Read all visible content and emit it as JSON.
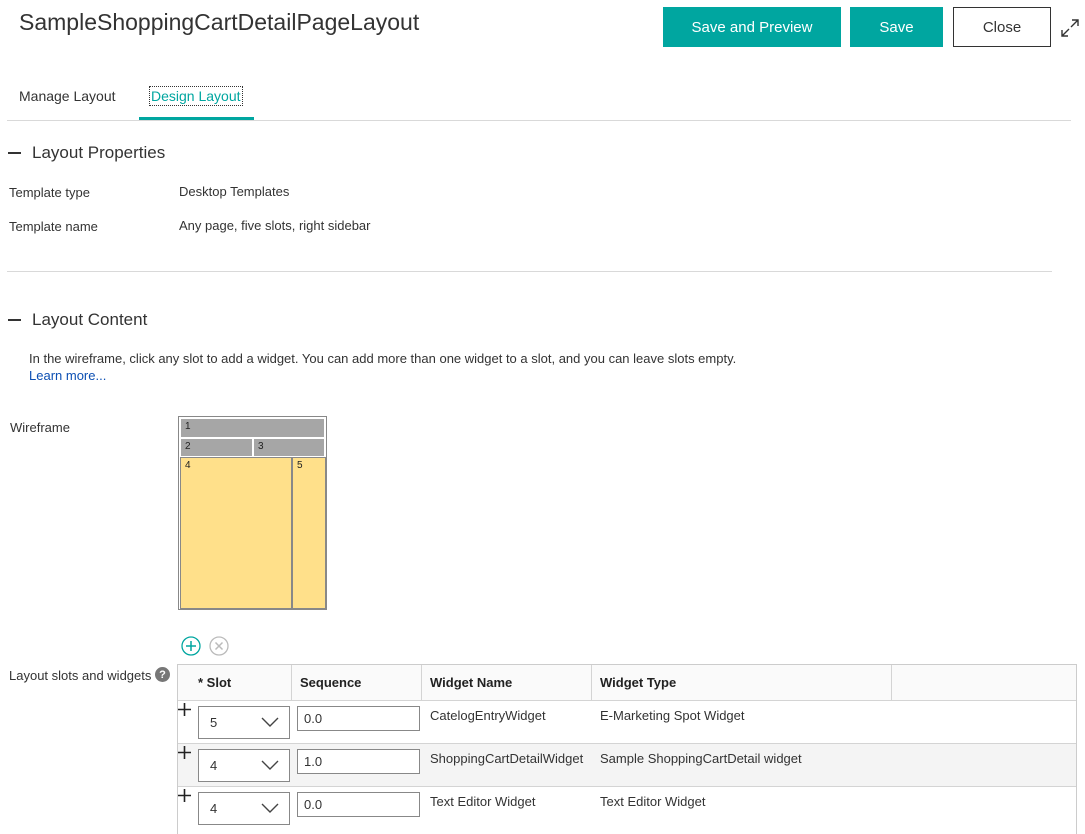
{
  "header": {
    "title": "SampleShoppingCartDetailPageLayout",
    "save_preview_label": "Save and Preview",
    "save_label": "Save",
    "close_label": "Close",
    "accent_color": "#00a6a0"
  },
  "tabs": [
    {
      "label": "Manage Layout",
      "active": false
    },
    {
      "label": "Design Layout",
      "active": true
    }
  ],
  "layout_properties": {
    "title": "Layout Properties",
    "template_type_label": "Template type",
    "template_type_value": "Desktop Templates",
    "template_name_label": "Template name",
    "template_name_value": "Any page, five slots, right sidebar"
  },
  "layout_content": {
    "title": "Layout Content",
    "instructions": "In the wireframe, click any slot to add a widget. You can add more than one widget to a slot, and you can leave slots empty.",
    "learn_more": "Learn more...",
    "wireframe_label": "Wireframe",
    "slots": [
      "1",
      "2",
      "3",
      "4",
      "5"
    ],
    "slots_widgets_label": "Layout slots and widgets"
  },
  "table": {
    "headers": {
      "slot": "* Slot",
      "sequence": "Sequence",
      "widget_name": "Widget Name",
      "widget_type": "Widget Type"
    },
    "rows": [
      {
        "slot": "5",
        "sequence": "0.0",
        "widget_name": "CatelogEntryWidget",
        "widget_type": "E-Marketing Spot Widget"
      },
      {
        "slot": "4",
        "sequence": "1.0",
        "widget_name": "ShoppingCartDetailWidget",
        "widget_type": "Sample ShoppingCartDetail widget"
      },
      {
        "slot": "4",
        "sequence": "0.0",
        "widget_name": "Text Editor Widget",
        "widget_type": "Text Editor Widget"
      }
    ]
  }
}
